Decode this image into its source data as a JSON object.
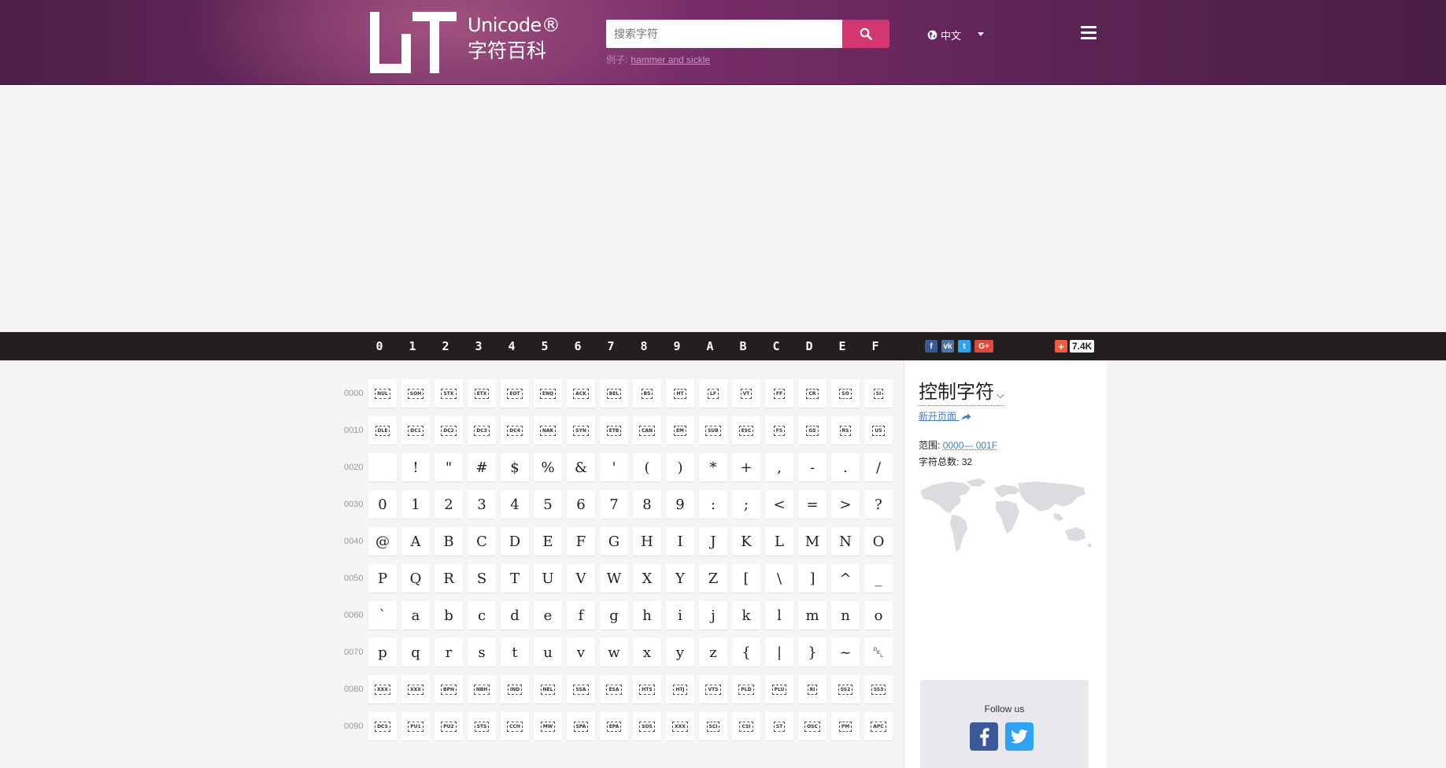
{
  "header": {
    "logo_line1": "Unicode®",
    "logo_line2": "字符百科",
    "search_placeholder": "搜索字符",
    "example_prefix": "例子:",
    "example_link": "hammer and sickle",
    "language": "中文",
    "colors": {
      "search_button": "#d2376f",
      "header_bg": "#6e2a63"
    }
  },
  "colbar": {
    "hex_columns": [
      "0",
      "1",
      "2",
      "3",
      "4",
      "5",
      "6",
      "7",
      "8",
      "9",
      "A",
      "B",
      "C",
      "D",
      "E",
      "F"
    ],
    "social": [
      {
        "name": "facebook",
        "glyph": "f",
        "color": "#3b5998"
      },
      {
        "name": "vk",
        "glyph": "vk",
        "color": "#4c75a3"
      },
      {
        "name": "twitter",
        "glyph": "t",
        "color": "#2ea3f2"
      },
      {
        "name": "google-plus",
        "glyph": "G+",
        "color": "#dd4b39"
      }
    ],
    "share_plus": "+",
    "share_count": "7.4K"
  },
  "grid": {
    "rows": [
      {
        "label": "0000",
        "type": "ctl",
        "cells": [
          "NUL",
          "SOH",
          "STX",
          "ETX",
          "EOT",
          "ENQ",
          "ACK",
          "BEL",
          "BS",
          "HT",
          "LF",
          "VT",
          "FF",
          "CR",
          "SO",
          "SI"
        ]
      },
      {
        "label": "0010",
        "type": "ctl",
        "cells": [
          "DLE",
          "DC1",
          "DC2",
          "DC3",
          "DC4",
          "NAK",
          "SYN",
          "ETB",
          "CAN",
          "EM",
          "SUB",
          "ESC",
          "FS",
          "GS",
          "RS",
          "US"
        ]
      },
      {
        "label": "0020",
        "type": "char",
        "cells": [
          " ",
          "!",
          "\"",
          "#",
          "$",
          "%",
          "&",
          "'",
          "(",
          ")",
          "*",
          "+",
          ",",
          "-",
          ".",
          "/"
        ]
      },
      {
        "label": "0030",
        "type": "char",
        "cells": [
          "0",
          "1",
          "2",
          "3",
          "4",
          "5",
          "6",
          "7",
          "8",
          "9",
          ":",
          ";",
          "<",
          "=",
          ">",
          "?"
        ]
      },
      {
        "label": "0040",
        "type": "char",
        "cells": [
          "@",
          "A",
          "B",
          "C",
          "D",
          "E",
          "F",
          "G",
          "H",
          "I",
          "J",
          "K",
          "L",
          "M",
          "N",
          "O"
        ]
      },
      {
        "label": "0050",
        "type": "char",
        "cells": [
          "P",
          "Q",
          "R",
          "S",
          "T",
          "U",
          "V",
          "W",
          "X",
          "Y",
          "Z",
          "[",
          "\\",
          "]",
          "^",
          "_"
        ]
      },
      {
        "label": "0060",
        "type": "char",
        "cells": [
          "`",
          "a",
          "b",
          "c",
          "d",
          "e",
          "f",
          "g",
          "h",
          "i",
          "j",
          "k",
          "l",
          "m",
          "n",
          "o"
        ]
      },
      {
        "label": "0070",
        "type": "char",
        "cells": [
          "p",
          "q",
          "r",
          "s",
          "t",
          "u",
          "v",
          "w",
          "x",
          "y",
          "z",
          "{",
          "|",
          "}",
          "~",
          "␡"
        ]
      },
      {
        "label": "0080",
        "type": "ctl",
        "cells": [
          "XXX",
          "XXX",
          "BPH",
          "NBH",
          "IND",
          "NEL",
          "SSA",
          "ESA",
          "HTS",
          "HTJ",
          "VTS",
          "PLD",
          "PLU",
          "RI",
          "SS2",
          "SS3"
        ]
      },
      {
        "label": "0090",
        "type": "ctl",
        "cells": [
          "DCS",
          "PU1",
          "PU2",
          "STS",
          "CCH",
          "MW",
          "SPA",
          "EPA",
          "SOS",
          "XXX",
          "SCI",
          "CSI",
          "ST",
          "OSC",
          "PM",
          "APC"
        ]
      }
    ]
  },
  "sidebar": {
    "title": "控制字符",
    "new_page": "新开页面",
    "range_label": "范围:",
    "range_value": "0000— 001F",
    "count_label": "字符总数:",
    "count_value": "32",
    "follow_title": "Follow us"
  }
}
